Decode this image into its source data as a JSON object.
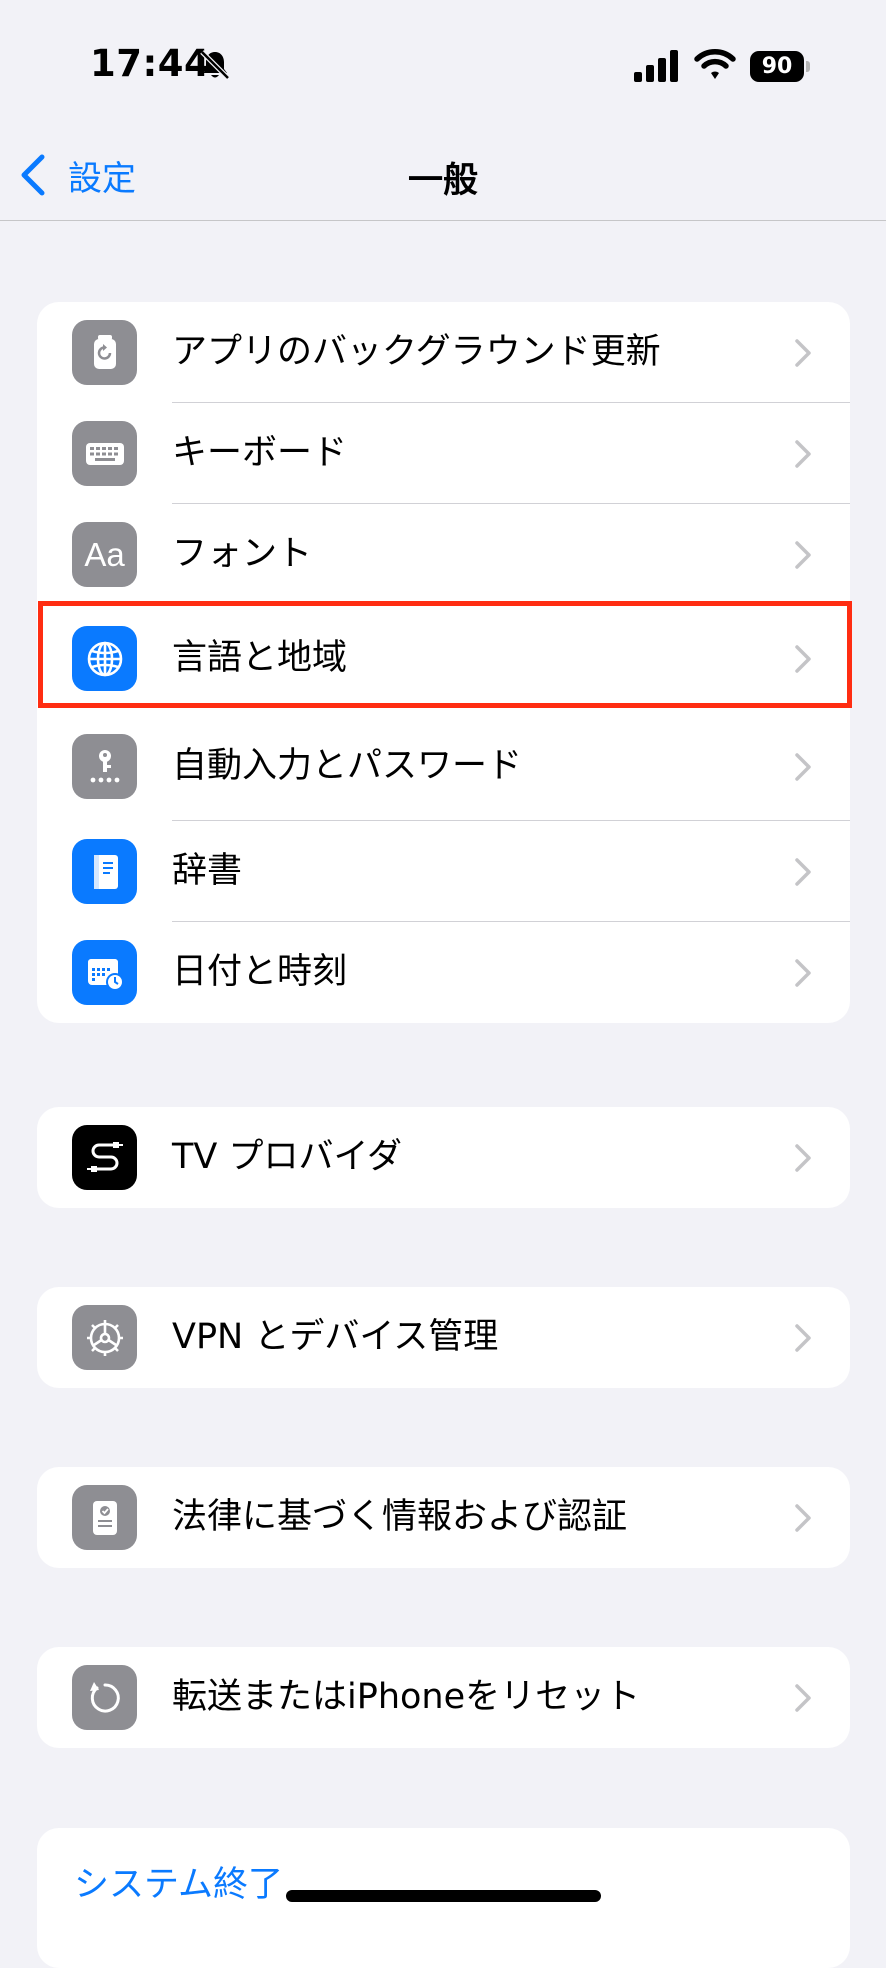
{
  "status": {
    "time": "17:44",
    "battery": "90",
    "bell_icon": "bell-slash-icon",
    "signal_icon": "cellular-signal-icon",
    "wifi_icon": "wifi-icon"
  },
  "nav": {
    "back_label": "設定",
    "title": "一般"
  },
  "groups": [
    {
      "rows": [
        {
          "label": "アプリのバックグラウンド更新",
          "icon": "background-refresh-icon",
          "icon_color": "#8e8e93"
        },
        {
          "label": "キーボード",
          "icon": "keyboard-icon",
          "icon_color": "#8e8e93"
        },
        {
          "label": "フォント",
          "icon": "font-aa-icon",
          "icon_text": "Aa",
          "icon_color": "#8e8e93"
        },
        {
          "label": "言語と地域",
          "icon": "globe-icon",
          "icon_color": "#0a7aff",
          "highlighted": true
        },
        {
          "label": "自動入力とパスワード",
          "icon": "key-icon",
          "icon_color": "#8e8e93"
        },
        {
          "label": "辞書",
          "icon": "dictionary-book-icon",
          "icon_color": "#0a7aff"
        },
        {
          "label": "日付と時刻",
          "icon": "calendar-clock-icon",
          "icon_color": "#0a7aff"
        }
      ]
    },
    {
      "rows": [
        {
          "label": "TV プロバイダ",
          "icon": "tv-provider-icon",
          "icon_color": "#000000"
        }
      ]
    },
    {
      "rows": [
        {
          "label": "VPN とデバイス管理",
          "icon": "gear-icon",
          "icon_color": "#8e8e93"
        }
      ]
    },
    {
      "rows": [
        {
          "label": "法律に基づく情報および認証",
          "icon": "certificate-icon",
          "icon_color": "#8e8e93"
        }
      ]
    },
    {
      "rows": [
        {
          "label": "転送またはiPhoneをリセット",
          "icon": "reset-arrow-icon",
          "icon_color": "#8e8e93"
        }
      ]
    }
  ],
  "shutdown_label": "システム終了",
  "colors": {
    "accent": "#0a7aff",
    "highlight": "#ff2d12",
    "background": "#f2f2f7"
  }
}
